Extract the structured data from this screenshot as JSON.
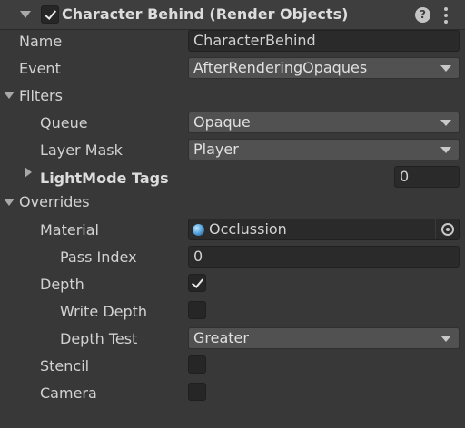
{
  "header": {
    "title": "Character Behind (Render Objects)",
    "enabled": true,
    "help_icon": "help-icon",
    "menu_icon": "kebab-icon"
  },
  "fields": {
    "name": {
      "label": "Name",
      "value": "CharacterBehind"
    },
    "event": {
      "label": "Event",
      "value": "AfterRenderingOpaques"
    }
  },
  "filters": {
    "label": "Filters",
    "queue": {
      "label": "Queue",
      "value": "Opaque"
    },
    "layer_mask": {
      "label": "Layer Mask",
      "value": "Player"
    },
    "lightmode_tags": {
      "label": "LightMode Tags",
      "value": "0"
    }
  },
  "overrides": {
    "label": "Overrides",
    "material": {
      "label": "Material",
      "value": "Occlussion",
      "icon": "material-icon"
    },
    "pass_index": {
      "label": "Pass Index",
      "value": "0"
    },
    "depth": {
      "label": "Depth",
      "checked": true
    },
    "write_depth": {
      "label": "Write Depth",
      "checked": false
    },
    "depth_test": {
      "label": "Depth Test",
      "value": "Greater"
    },
    "stencil": {
      "label": "Stencil",
      "checked": false
    },
    "camera": {
      "label": "Camera",
      "checked": false
    }
  },
  "colors": {
    "background": "#383838",
    "field": "#2a2a2a",
    "dropdown": "#515151",
    "text": "#d2d2d2"
  }
}
